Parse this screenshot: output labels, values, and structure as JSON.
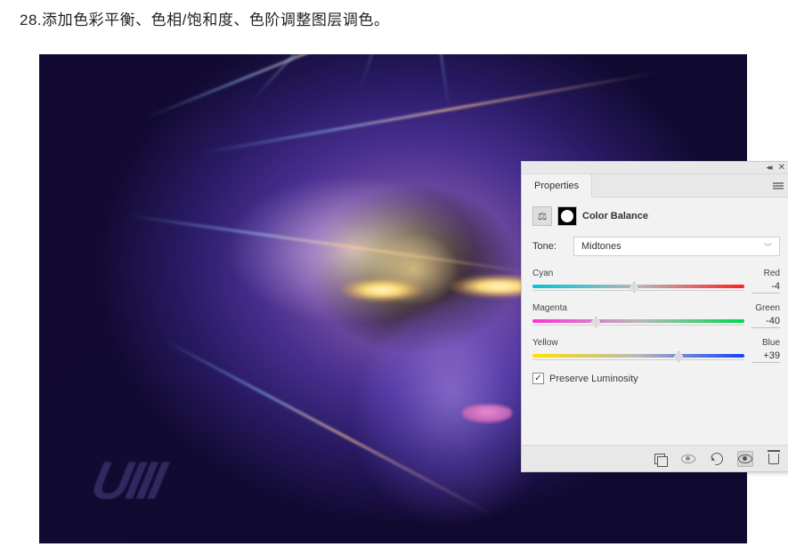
{
  "title": "28.添加色彩平衡、色相/饱和度、色阶调整图层调色。",
  "watermark": "UIII",
  "panel": {
    "tab": "Properties",
    "adjustment": "Color Balance",
    "tone_label": "Tone:",
    "tone_value": "Midtones",
    "sliders": [
      {
        "left": "Cyan",
        "right": "Red",
        "value": "-4",
        "pos_pct": 48
      },
      {
        "left": "Magenta",
        "right": "Green",
        "value": "-40",
        "pos_pct": 30
      },
      {
        "left": "Yellow",
        "right": "Blue",
        "value": "+39",
        "pos_pct": 69
      }
    ],
    "preserve_label": "Preserve Luminosity",
    "preserve_checked": true
  }
}
